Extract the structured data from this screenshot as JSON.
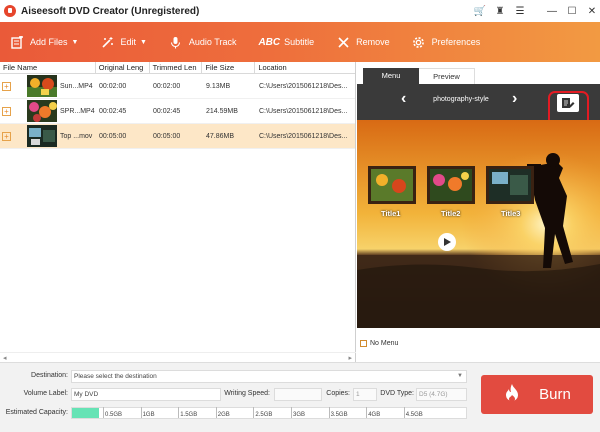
{
  "app": {
    "title": "Aiseesoft DVD Creator (Unregistered)"
  },
  "window_controls": {
    "cart": "🛒",
    "user": "♜",
    "menu": "☰",
    "minimize": "—",
    "maximize": "☐",
    "close": "✕"
  },
  "toolbar": {
    "add_files": "Add Files",
    "edit": "Edit",
    "audio_track": "Audio Track",
    "subtitle_prefix": "ABC",
    "subtitle": "Subtitle",
    "remove": "Remove",
    "preferences": "Preferences"
  },
  "file_list": {
    "columns": [
      "File Name",
      "Original Leng",
      "Trimmed Len",
      "File Size",
      "Location"
    ],
    "rows": [
      {
        "name": "Sun...MP4",
        "original": "00:02:00",
        "trimmed": "00:02:00",
        "size": "9.13MB",
        "location": "C:\\Users\\2015061218\\Des..."
      },
      {
        "name": "SPR...MP4",
        "original": "00:02:45",
        "trimmed": "00:02:45",
        "size": "214.59MB",
        "location": "C:\\Users\\2015061218\\Des..."
      },
      {
        "name": "Top ...mov",
        "original": "00:05:00",
        "trimmed": "00:05:00",
        "size": "47.86MB",
        "location": "C:\\Users\\2015061218\\Des..."
      }
    ],
    "expand_glyph": "+"
  },
  "preview": {
    "tabs": [
      "Menu",
      "Preview"
    ],
    "active_tab": "Menu",
    "style_name": "photography-style",
    "prev_arrow": "‹",
    "next_arrow": "›",
    "titles": [
      "Title1",
      "Title2",
      "Title3"
    ],
    "no_menu_label": "No Menu",
    "scroll_left": "◂",
    "scroll_right": "▸"
  },
  "bottom": {
    "destination_label": "Destination:",
    "destination_placeholder": "Please select the destination",
    "volume_label": "Volume Label:",
    "volume_value": "My DVD",
    "writing_speed_label": "Writing Speed:",
    "copies_label": "Copies:",
    "copies_value": "1",
    "dvd_type_label": "DVD Type:",
    "dvd_type_value": "D5 (4.7G)",
    "capacity_label": "Estimated Capacity:",
    "capacity_ticks": [
      "0.5GB",
      "1GB",
      "1.5GB",
      "2GB",
      "2.5GB",
      "3GB",
      "3.5GB",
      "4GB",
      "4.5GB"
    ],
    "capacity_used_fraction": 0.068,
    "burn_label": "Burn"
  },
  "colors": {
    "accent": "#ea5a39",
    "burn": "#e24b40",
    "selected_row": "#fde7c7",
    "capacity_fill": "#66e3b5"
  }
}
